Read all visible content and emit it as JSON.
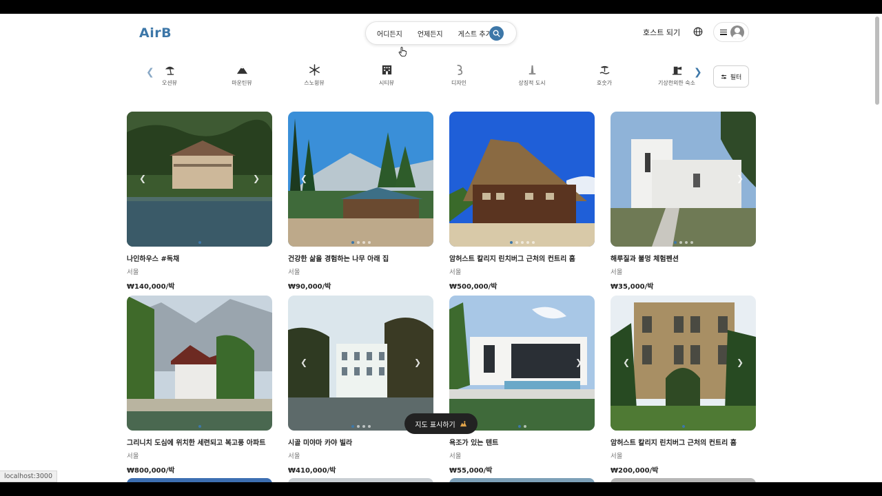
{
  "app": {
    "logo": "AirB"
  },
  "search": {
    "where": "어디든지",
    "when": "언제든지",
    "guests": "게스트 추가"
  },
  "header": {
    "host_label": "호스트 되기"
  },
  "categories": [
    {
      "label": "오션뷰",
      "icon": "beach-umbrella-icon"
    },
    {
      "label": "마운틴뷰",
      "icon": "mountain-icon"
    },
    {
      "label": "스노윙뷰",
      "icon": "snowflake-icon"
    },
    {
      "label": "시티뷰",
      "icon": "building-icon"
    },
    {
      "label": "디자인",
      "icon": "design-icon"
    },
    {
      "label": "상징적 도시",
      "icon": "landmark-icon"
    },
    {
      "label": "호숫가",
      "icon": "lake-icon"
    },
    {
      "label": "기상천외한 숙소",
      "icon": "unique-house-icon"
    }
  ],
  "filter": {
    "label": "필터"
  },
  "listings": [
    {
      "title": "나인하우스 #독채",
      "location": "서울",
      "price": "₩140,000/박"
    },
    {
      "title": "건강한 삶을 경험하는 나무 아래 집",
      "location": "서울",
      "price": "₩90,000/박"
    },
    {
      "title": "암허스트 칼리지 린치버그 근처의 컨트리 홈",
      "location": "서울",
      "price": "₩500,000/박"
    },
    {
      "title": "해루질과 불멍 체험펜션",
      "location": "서울",
      "price": "₩35,000/박"
    },
    {
      "title": "그리니치 도심에 위치한 세련되고 복고풍 아파트",
      "location": "서울",
      "price": "₩800,000/박"
    },
    {
      "title": "시골 미야마 카야 빌라",
      "location": "서울",
      "price": "₩410,000/박"
    },
    {
      "title": "욕조가 있는 텐트",
      "location": "서울",
      "price": "₩55,000/박"
    },
    {
      "title": "암허스트 칼리지 린치버그 근처의 컨트리 홈",
      "location": "서울",
      "price": "₩200,000/박"
    }
  ],
  "map_button": {
    "label": "지도 표시하기"
  },
  "status_bar": {
    "url": "localhost:3000"
  },
  "colors": {
    "accent": "#3d77a8"
  }
}
